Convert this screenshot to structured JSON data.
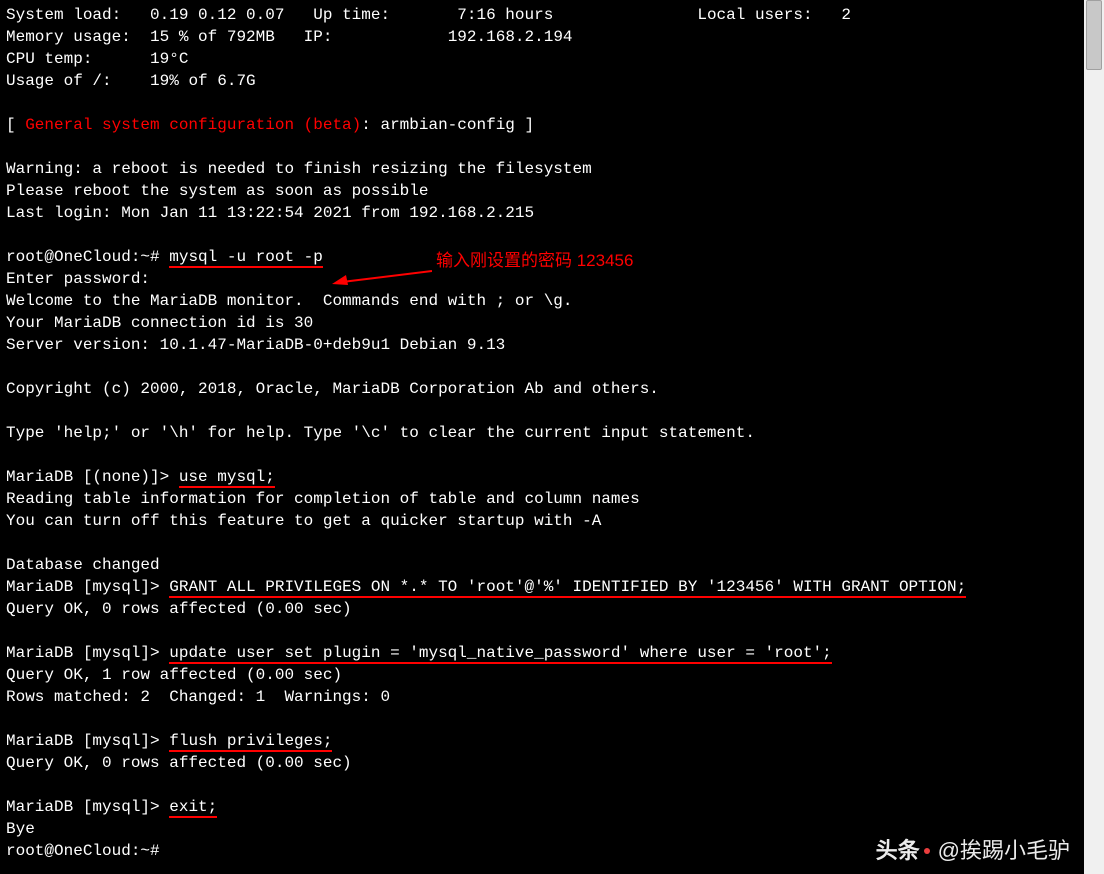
{
  "stats": {
    "sysload_label": "System load:",
    "sysload_value": "0.19 0.12 0.07",
    "uptime_label": "Up time:",
    "uptime_value": "7:16 hours",
    "localusers_label": "Local users:",
    "localusers_value": "2",
    "mem_label": "Memory usage:",
    "mem_value": "15 % of 792MB",
    "ip_label": "IP:",
    "ip_value": "192.168.2.194",
    "cpu_label": "CPU temp:",
    "cpu_value": "19°C",
    "disk_label": "Usage of /:",
    "disk_value": "19% of 6.7G"
  },
  "config": {
    "bracket_open": "[ ",
    "text": "General system configuration (beta)",
    "suffix": ": armbian-config ]"
  },
  "warning": {
    "line1": "Warning: a reboot is needed to finish resizing the filesystem",
    "line2": "Please reboot the system as soon as possible",
    "lastlogin": "Last login: Mon Jan 11 13:22:54 2021 from 192.168.2.215"
  },
  "shell": {
    "prompt1": "root@OneCloud:~# ",
    "cmd1": "mysql -u root -p",
    "enter_pw": "Enter password:",
    "welcome": "Welcome to the MariaDB monitor.  Commands end with ; or \\g.",
    "conn_id": "Your MariaDB connection id is 30",
    "server_ver": "Server version: 10.1.47-MariaDB-0+deb9u1 Debian 9.13",
    "copyright": "Copyright (c) 2000, 2018, Oracle, MariaDB Corporation Ab and others.",
    "help": "Type 'help;' or '\\h' for help. Type '\\c' to clear the current input statement."
  },
  "maria": {
    "prompt_none": "MariaDB [(none)]> ",
    "cmd_use": "use mysql;",
    "reading": "Reading table information for completion of table and column names",
    "turnoff": "You can turn off this feature to get a quicker startup with -A",
    "db_changed": "Database changed",
    "prompt_mysql": "MariaDB [mysql]> ",
    "cmd_grant": "GRANT ALL PRIVILEGES ON *.* TO 'root'@'%' IDENTIFIED BY '123456' WITH GRANT OPTION;",
    "ok0": "Query OK, 0 rows affected (0.00 sec)",
    "cmd_update": "update user set plugin = 'mysql_native_password' where user = 'root';",
    "ok1": "Query OK, 1 row affected (0.00 sec)",
    "rows_matched": "Rows matched: 2  Changed: 1  Warnings: 0",
    "cmd_flush": "flush privileges;",
    "cmd_exit": "exit;",
    "bye": "Bye",
    "prompt_end": "root@OneCloud:~#"
  },
  "annotation": {
    "text": "输入刚设置的密码 123456"
  },
  "watermark": {
    "logo": "头条",
    "handle": "@挨踢小毛驴"
  }
}
